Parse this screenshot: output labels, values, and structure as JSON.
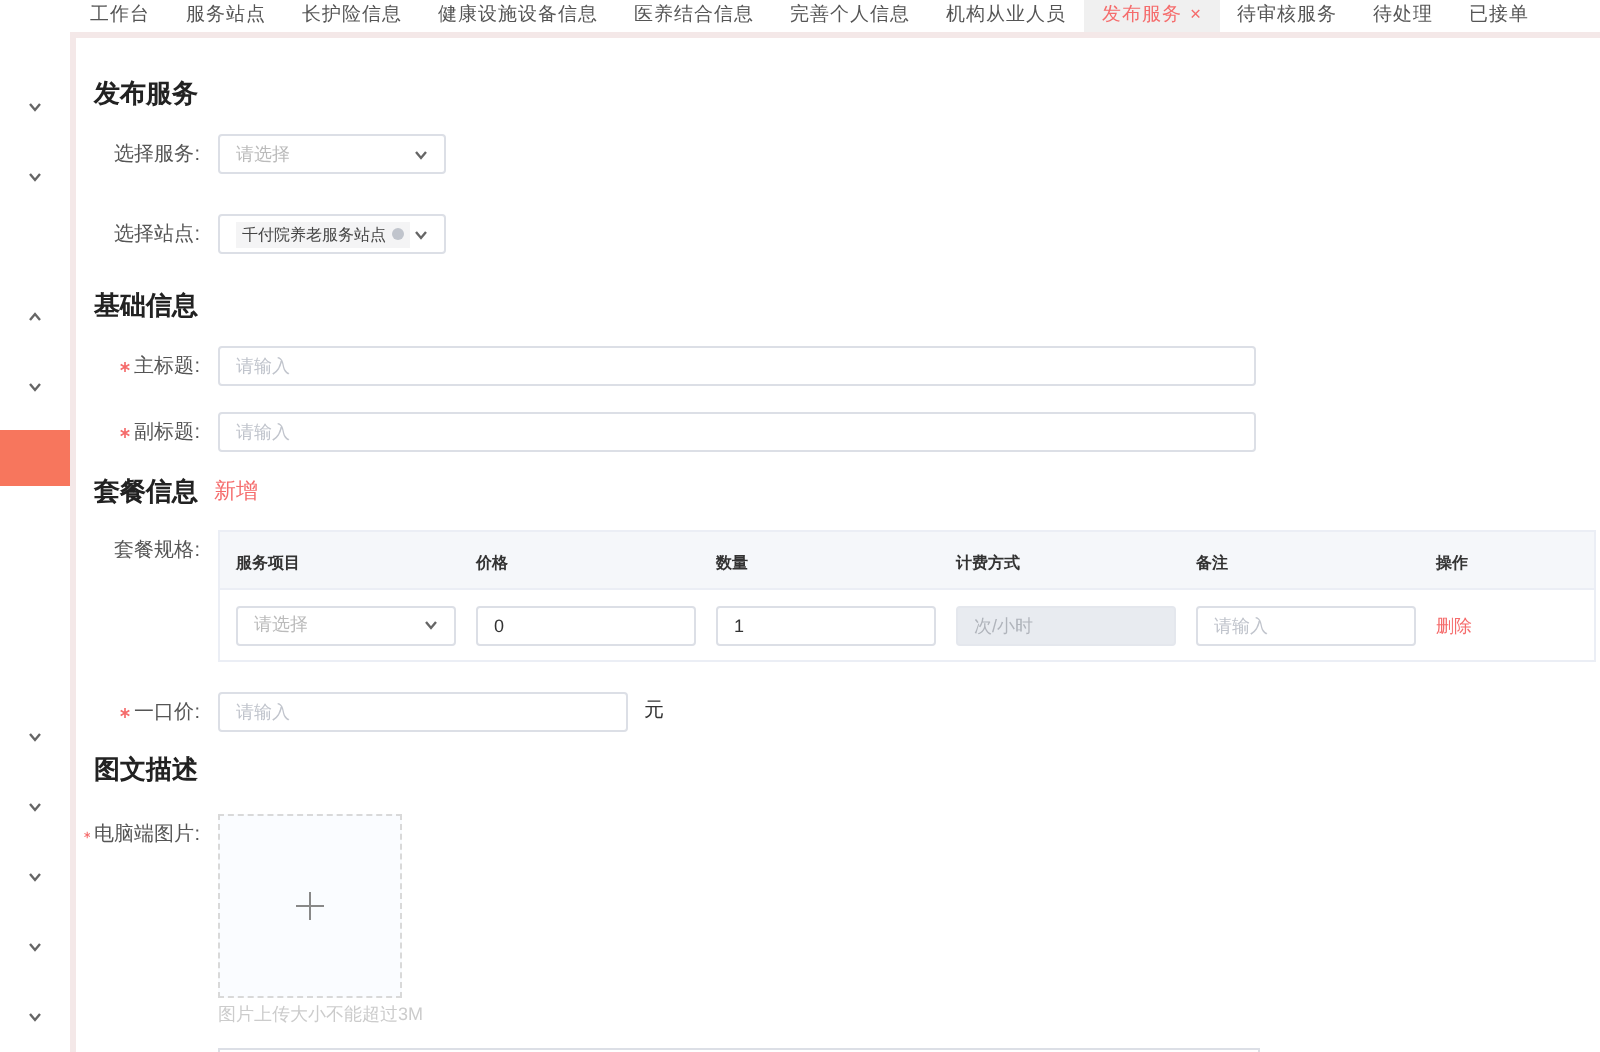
{
  "tabs": [
    {
      "label": "工作台",
      "selected": false
    },
    {
      "label": "服务站点",
      "selected": false
    },
    {
      "label": "长护险信息",
      "selected": false
    },
    {
      "label": "健康设施设备信息",
      "selected": false
    },
    {
      "label": "医养结合信息",
      "selected": false
    },
    {
      "label": "完善个人信息",
      "selected": false
    },
    {
      "label": "机构从业人员",
      "selected": false
    },
    {
      "label": "发布服务",
      "close": "×",
      "selected": true
    },
    {
      "label": "待审核服务",
      "selected": false
    },
    {
      "label": "待处理",
      "selected": false
    },
    {
      "label": "已接单",
      "selected": false
    }
  ],
  "sidebar": {
    "items": [
      {
        "kind": "group",
        "expanded": false,
        "selected": false
      },
      {
        "kind": "group",
        "expanded": false,
        "selected": false
      },
      {
        "kind": "item",
        "selected": false
      },
      {
        "kind": "group",
        "expanded": true,
        "selected": false
      },
      {
        "kind": "group",
        "expanded": false,
        "selected": false
      },
      {
        "kind": "item",
        "selected": true
      },
      {
        "kind": "item",
        "selected": false
      },
      {
        "kind": "item",
        "selected": false
      },
      {
        "kind": "item",
        "selected": false
      },
      {
        "kind": "group",
        "expanded": false,
        "selected": false
      },
      {
        "kind": "group",
        "expanded": false,
        "selected": false
      },
      {
        "kind": "group",
        "expanded": false,
        "selected": false
      },
      {
        "kind": "group",
        "expanded": false,
        "selected": false
      },
      {
        "kind": "group",
        "expanded": false,
        "selected": false
      }
    ]
  },
  "publish": {
    "heading": "发布服务",
    "fields": [
      {
        "label": "选择服务:",
        "kind": "select",
        "placeholder": "请选择",
        "required": false
      },
      {
        "label": "选择站点:",
        "kind": "select",
        "tag": "千付院养老服务站点",
        "required": false
      }
    ]
  },
  "basic": {
    "heading": "基础信息",
    "fields": [
      {
        "label": "主标题:",
        "kind": "input",
        "placeholder": "请输入",
        "required": true
      },
      {
        "label": "副标题:",
        "kind": "input",
        "placeholder": "请输入",
        "required": true
      }
    ]
  },
  "package": {
    "heading": "套餐信息",
    "add_link": "新增",
    "label": "套餐规格:",
    "columns": [
      "服务项目",
      "价格",
      "数量",
      "计费方式",
      "备注",
      "操作"
    ],
    "rows": [
      {
        "cells": [
          {
            "kind": "select",
            "placeholder": "请选择"
          },
          {
            "kind": "input",
            "value": "0",
            "disabled": false
          },
          {
            "kind": "input",
            "value": "1",
            "disabled": false
          },
          {
            "kind": "input",
            "placeholder": "次/小时",
            "disabled": true
          },
          {
            "kind": "input",
            "placeholder": "请输入",
            "disabled": false
          },
          {
            "kind": "link",
            "text": "删除"
          }
        ]
      }
    ],
    "price": {
      "label": "一口价:",
      "placeholder": "请输入",
      "unit": "元",
      "required": true
    }
  },
  "description": {
    "heading": "图文描述",
    "upload": {
      "label": "电脑端图片:",
      "required": true,
      "hint": "图片上传大小不能超过3M"
    }
  }
}
